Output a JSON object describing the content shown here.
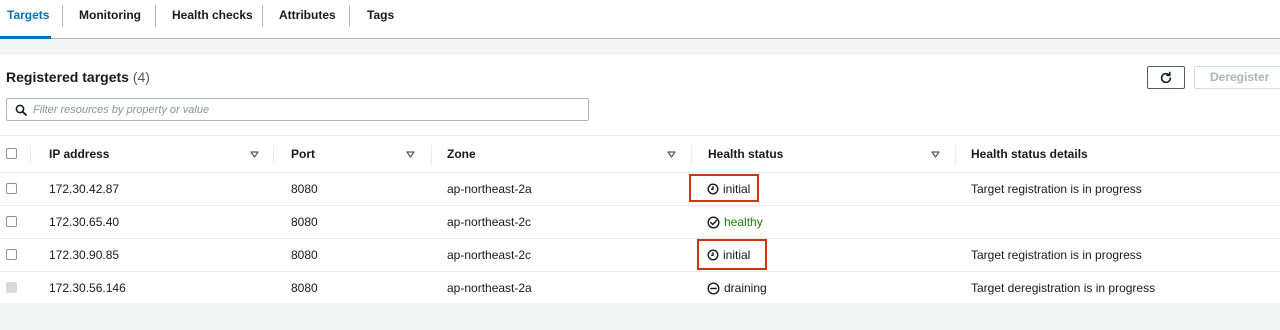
{
  "tabs": [
    {
      "label": "Targets",
      "active": true
    },
    {
      "label": "Monitoring",
      "active": false
    },
    {
      "label": "Health checks",
      "active": false
    },
    {
      "label": "Attributes",
      "active": false
    },
    {
      "label": "Tags",
      "active": false
    }
  ],
  "panel": {
    "title": "Registered targets",
    "count": "(4)",
    "deregister_label": "Deregister",
    "refresh_icon": "refresh-icon"
  },
  "search": {
    "placeholder": "Filter resources by property or value",
    "value": ""
  },
  "columns": [
    "IP address",
    "Port",
    "Zone",
    "Health status",
    "Health status details"
  ],
  "rows": [
    {
      "ip": "172.30.42.87",
      "port": "8080",
      "zone": "ap-northeast-2a",
      "status": "initial",
      "details": "Target registration is in progress",
      "highlighted": true,
      "disabled": false
    },
    {
      "ip": "172.30.65.40",
      "port": "8080",
      "zone": "ap-northeast-2c",
      "status": "healthy",
      "details": "",
      "highlighted": false,
      "disabled": false
    },
    {
      "ip": "172.30.90.85",
      "port": "8080",
      "zone": "ap-northeast-2c",
      "status": "initial",
      "details": "Target registration is in progress",
      "highlighted": true,
      "disabled": false
    },
    {
      "ip": "172.30.56.146",
      "port": "8080",
      "zone": "ap-northeast-2a",
      "status": "draining",
      "details": "Target deregistration is in progress",
      "highlighted": false,
      "disabled": true
    }
  ],
  "colors": {
    "accent": "#0073bb",
    "healthy": "#1d8102",
    "highlight": "#d13212"
  }
}
